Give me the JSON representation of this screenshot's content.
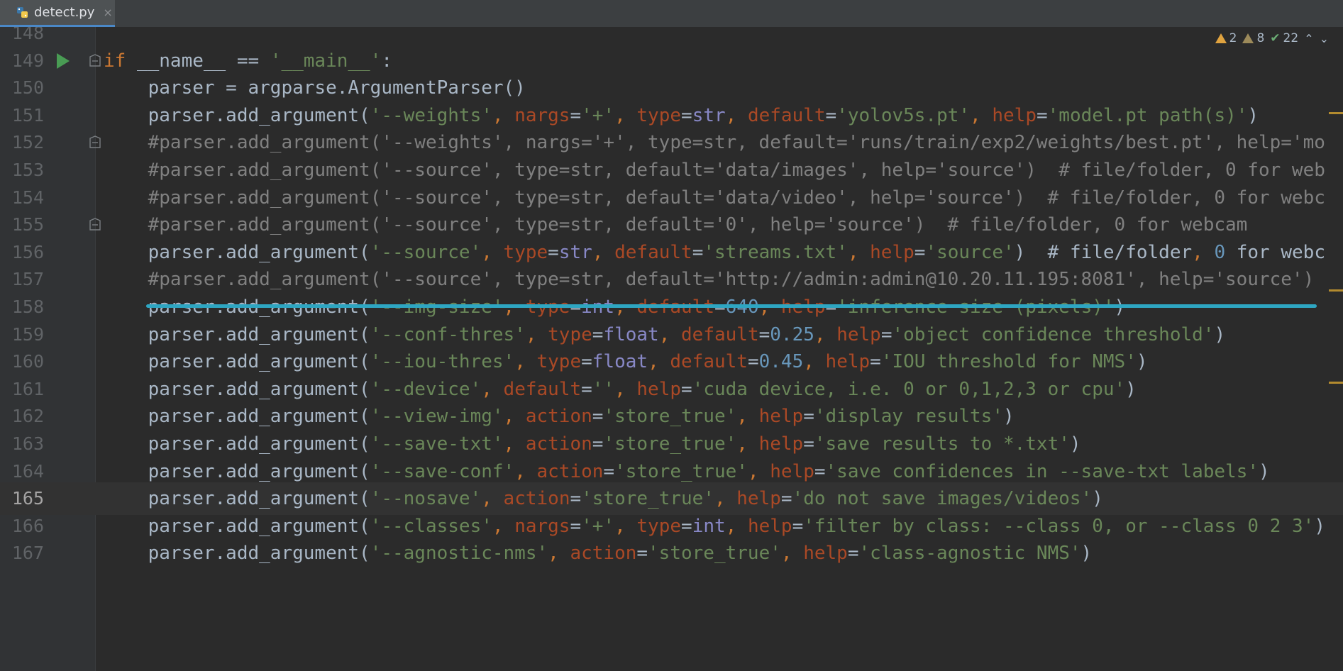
{
  "tab": {
    "filename": "detect.py",
    "close_glyph": "×"
  },
  "inspections": {
    "errors_count": "2",
    "warnings_count": "8",
    "ok_count": "22"
  },
  "lines": [
    {
      "num": "148",
      "code": ""
    },
    {
      "num": "149",
      "code": "if __name__ == '__main__':"
    },
    {
      "num": "150",
      "code": "    parser = argparse.ArgumentParser()"
    },
    {
      "num": "151",
      "code": "    parser.add_argument('--weights', nargs='+', type=str, default='yolov5s.pt', help='model.pt path(s)')"
    },
    {
      "num": "152",
      "code": "    #parser.add_argument('--weights', nargs='+', type=str, default='runs/train/exp2/weights/best.pt', help='mo"
    },
    {
      "num": "153",
      "code": "    #parser.add_argument('--source', type=str, default='data/images', help='source')  # file/folder, 0 for web"
    },
    {
      "num": "154",
      "code": "    #parser.add_argument('--source', type=str, default='data/video', help='source')  # file/folder, 0 for webc"
    },
    {
      "num": "155",
      "code": "    #parser.add_argument('--source', type=str, default='0', help='source')  # file/folder, 0 for webcam"
    },
    {
      "num": "156",
      "code": "    parser.add_argument('--source', type=str, default='streams.txt', help='source')  # file/folder, 0 for webc"
    },
    {
      "num": "157",
      "code": "    #parser.add_argument('--source', type=str, default='http://admin:admin@10.20.11.195:8081', help='source')"
    },
    {
      "num": "158",
      "code": "    parser.add_argument('--img-size', type=int, default=640, help='inference size (pixels)')"
    },
    {
      "num": "159",
      "code": "    parser.add_argument('--conf-thres', type=float, default=0.25, help='object confidence threshold')"
    },
    {
      "num": "160",
      "code": "    parser.add_argument('--iou-thres', type=float, default=0.45, help='IOU threshold for NMS')"
    },
    {
      "num": "161",
      "code": "    parser.add_argument('--device', default='', help='cuda device, i.e. 0 or 0,1,2,3 or cpu')"
    },
    {
      "num": "162",
      "code": "    parser.add_argument('--view-img', action='store_true', help='display results')"
    },
    {
      "num": "163",
      "code": "    parser.add_argument('--save-txt', action='store_true', help='save results to *.txt')"
    },
    {
      "num": "164",
      "code": "    parser.add_argument('--save-conf', action='store_true', help='save confidences in --save-txt labels')"
    },
    {
      "num": "165",
      "code": "    parser.add_argument('--nosave', action='store_true', help='do not save images/videos')"
    },
    {
      "num": "166",
      "code": "    parser.add_argument('--classes', nargs='+', type=int, help='filter by class: --class 0, or --class 0 2 3')"
    },
    {
      "num": "167",
      "code": "    parser.add_argument('--agnostic-nms', action='store_true', help='class-agnostic NMS')"
    }
  ],
  "current_line": "165"
}
